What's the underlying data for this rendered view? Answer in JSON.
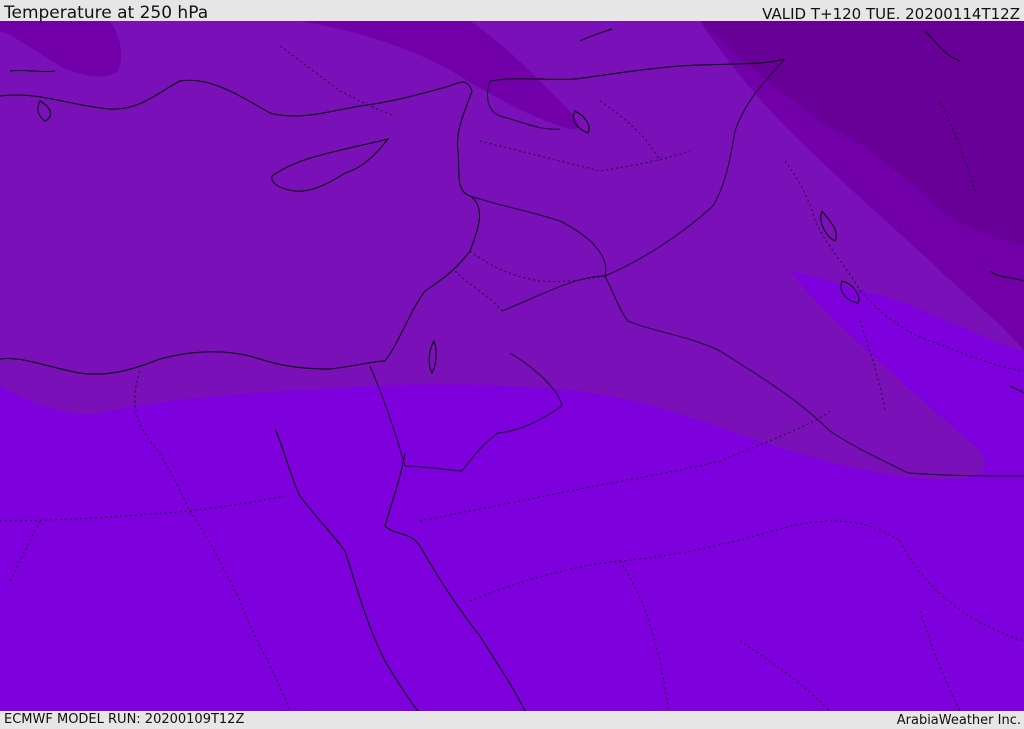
{
  "header": {
    "title": "Temperature at 250 hPa",
    "valid_time": "VALID T+120 TUE. 20200114T12Z"
  },
  "footer": {
    "model_run": "ECMWF MODEL RUN: 20200109T12Z",
    "credit": "ArabiaWeather Inc."
  },
  "colors": {
    "band_coldest": "#680098",
    "band_cold": "#7200a8",
    "band_mid": "#7a10b8",
    "band_warm": "#7e00dc",
    "coastline": "#000000",
    "border": "#1a0030"
  }
}
